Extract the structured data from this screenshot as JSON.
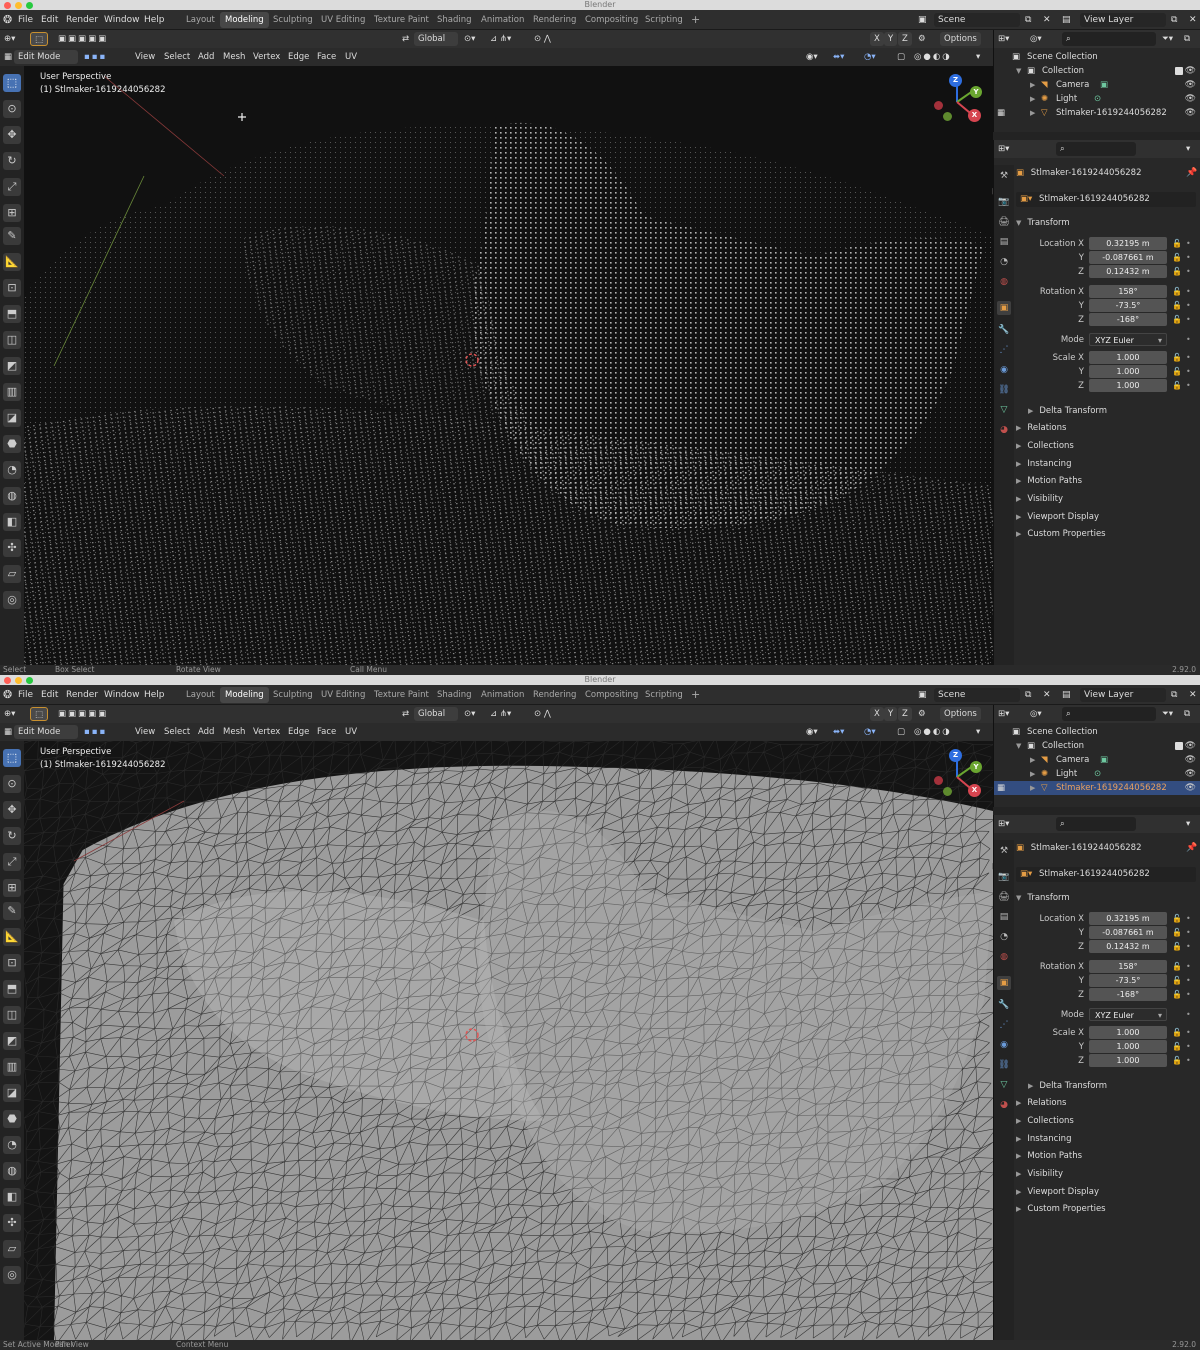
{
  "app": {
    "title": "Blender",
    "version": "2.92.0"
  },
  "menus": [
    "File",
    "Edit",
    "Render",
    "Window",
    "Help"
  ],
  "workspaces": [
    "Layout",
    "Modeling",
    "Sculpting",
    "UV Editing",
    "Texture Paint",
    "Shading",
    "Animation",
    "Rendering",
    "Compositing",
    "Scripting"
  ],
  "active_workspace": "Modeling",
  "add_workspace": "+",
  "scene": "Scene",
  "view_layer": "View Layer",
  "header": {
    "mode": "Edit Mode",
    "menu": [
      "View",
      "Select",
      "Add",
      "Mesh",
      "Vertex",
      "Edge",
      "Face",
      "UV"
    ],
    "orientation": "Global",
    "axes": [
      "X",
      "Y",
      "Z"
    ],
    "options": "Options"
  },
  "viewport": {
    "perspective": "User Perspective",
    "object": "(1) Stlmaker-1619244056282"
  },
  "gizmo": {
    "x": "X",
    "y": "Y",
    "z": "Z"
  },
  "outliner": {
    "root": "Scene Collection",
    "collection": "Collection",
    "items": [
      "Camera",
      "Light",
      "Stlmaker-1619244056282"
    ]
  },
  "properties": {
    "object_name": "Stlmaker-1619244056282",
    "data_name": "Stlmaker-1619244056282",
    "transform": "Transform",
    "location_label": "Location X",
    "rotation_label": "Rotation X",
    "scale_label": "Scale X",
    "y_label": "Y",
    "z_label": "Z",
    "mode_label": "Mode",
    "location": [
      "0.32195 m",
      "-0.087661 m",
      "0.12432 m"
    ],
    "rotation": [
      "158°",
      "-73.5°",
      "-168°"
    ],
    "mode": "XYZ Euler",
    "scale": [
      "1.000",
      "1.000",
      "1.000"
    ],
    "delta": "Delta Transform",
    "panels": [
      "Relations",
      "Collections",
      "Instancing",
      "Motion Paths",
      "Visibility",
      "Viewport Display",
      "Custom Properties"
    ]
  },
  "windows": [
    {
      "status": [
        "Select",
        "Box Select",
        "Rotate View",
        "Call Menu"
      ],
      "outliner_selected": false
    },
    {
      "status": [
        "Set Active Modifier",
        "Pan View",
        "Context Menu"
      ],
      "outliner_selected": true
    }
  ],
  "colors": {
    "accent": "#4772b3",
    "selected_row": "#334d80",
    "traffic": [
      "#ff5f56",
      "#ffbd2e",
      "#27c93f"
    ]
  }
}
